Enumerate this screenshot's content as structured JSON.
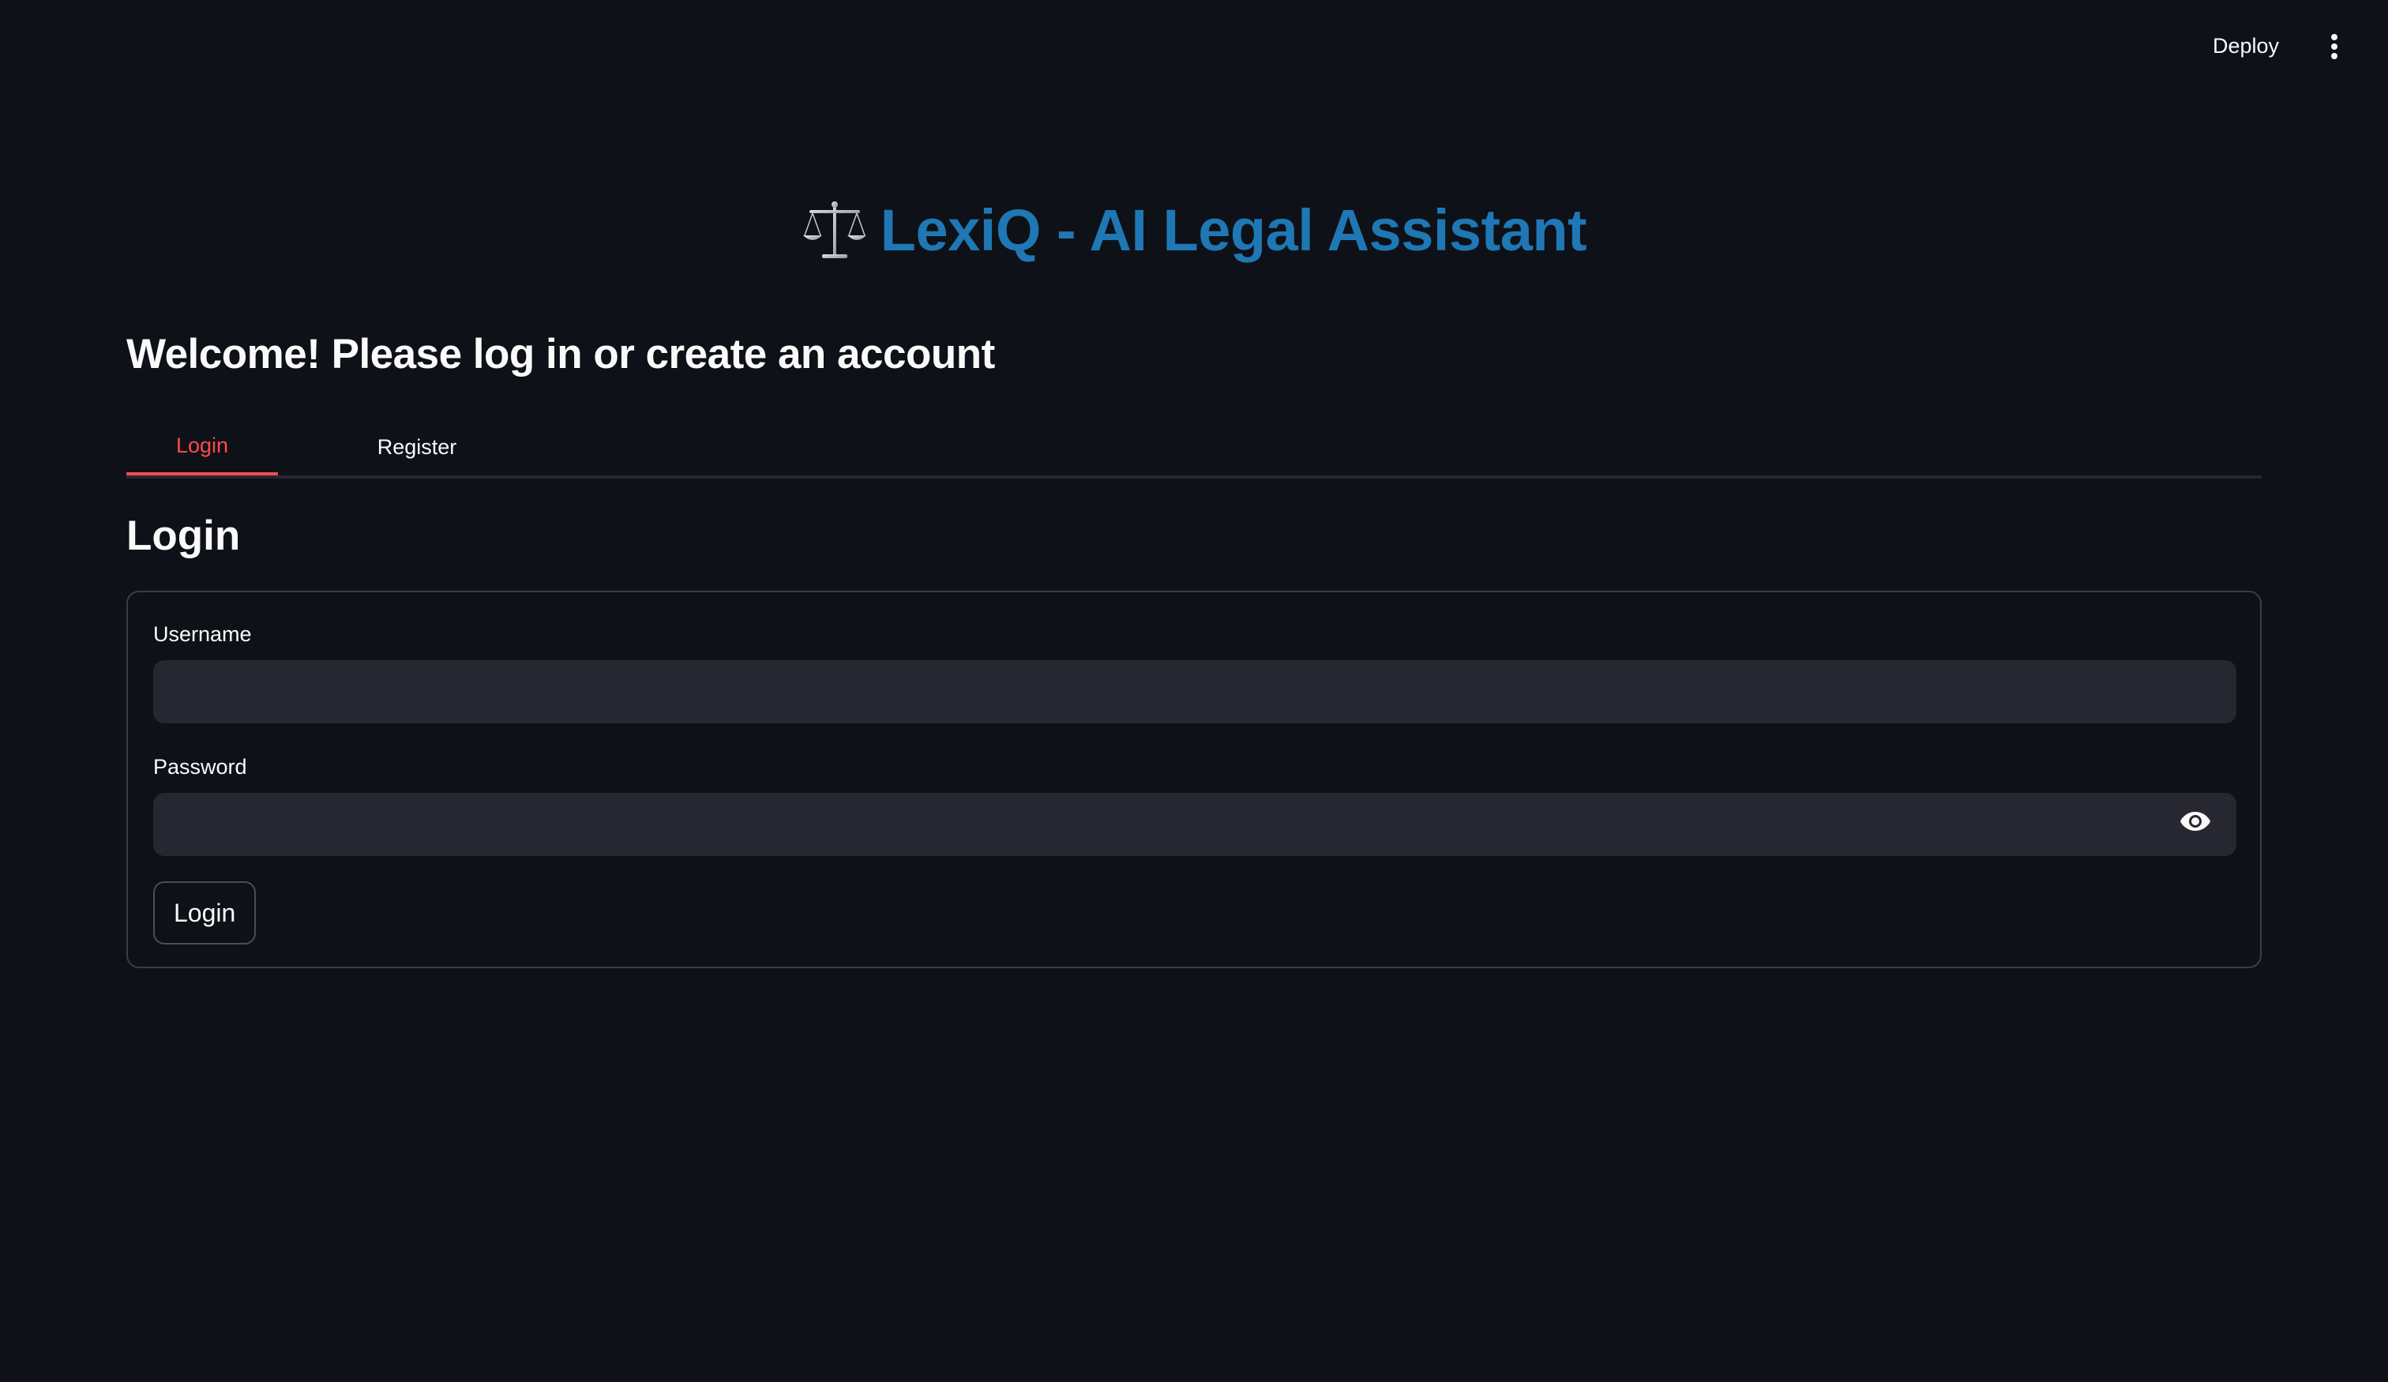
{
  "header": {
    "deploy_label": "Deploy",
    "menu_icon": "kebab-vertical-icon"
  },
  "title": {
    "icon": "balance-scale-icon",
    "text": "LexiQ - AI Legal Assistant",
    "color": "#1f77b4"
  },
  "subtitle": "Welcome! Please log in or create an account",
  "tabs": [
    {
      "label": "Login",
      "active": true
    },
    {
      "label": "Register",
      "active": false
    }
  ],
  "accent_color": "#ff4b4b",
  "login_form": {
    "heading": "Login",
    "username_label": "Username",
    "username_value": "",
    "password_label": "Password",
    "password_value": "",
    "password_toggle_icon": "eye-icon",
    "submit_label": "Login"
  }
}
